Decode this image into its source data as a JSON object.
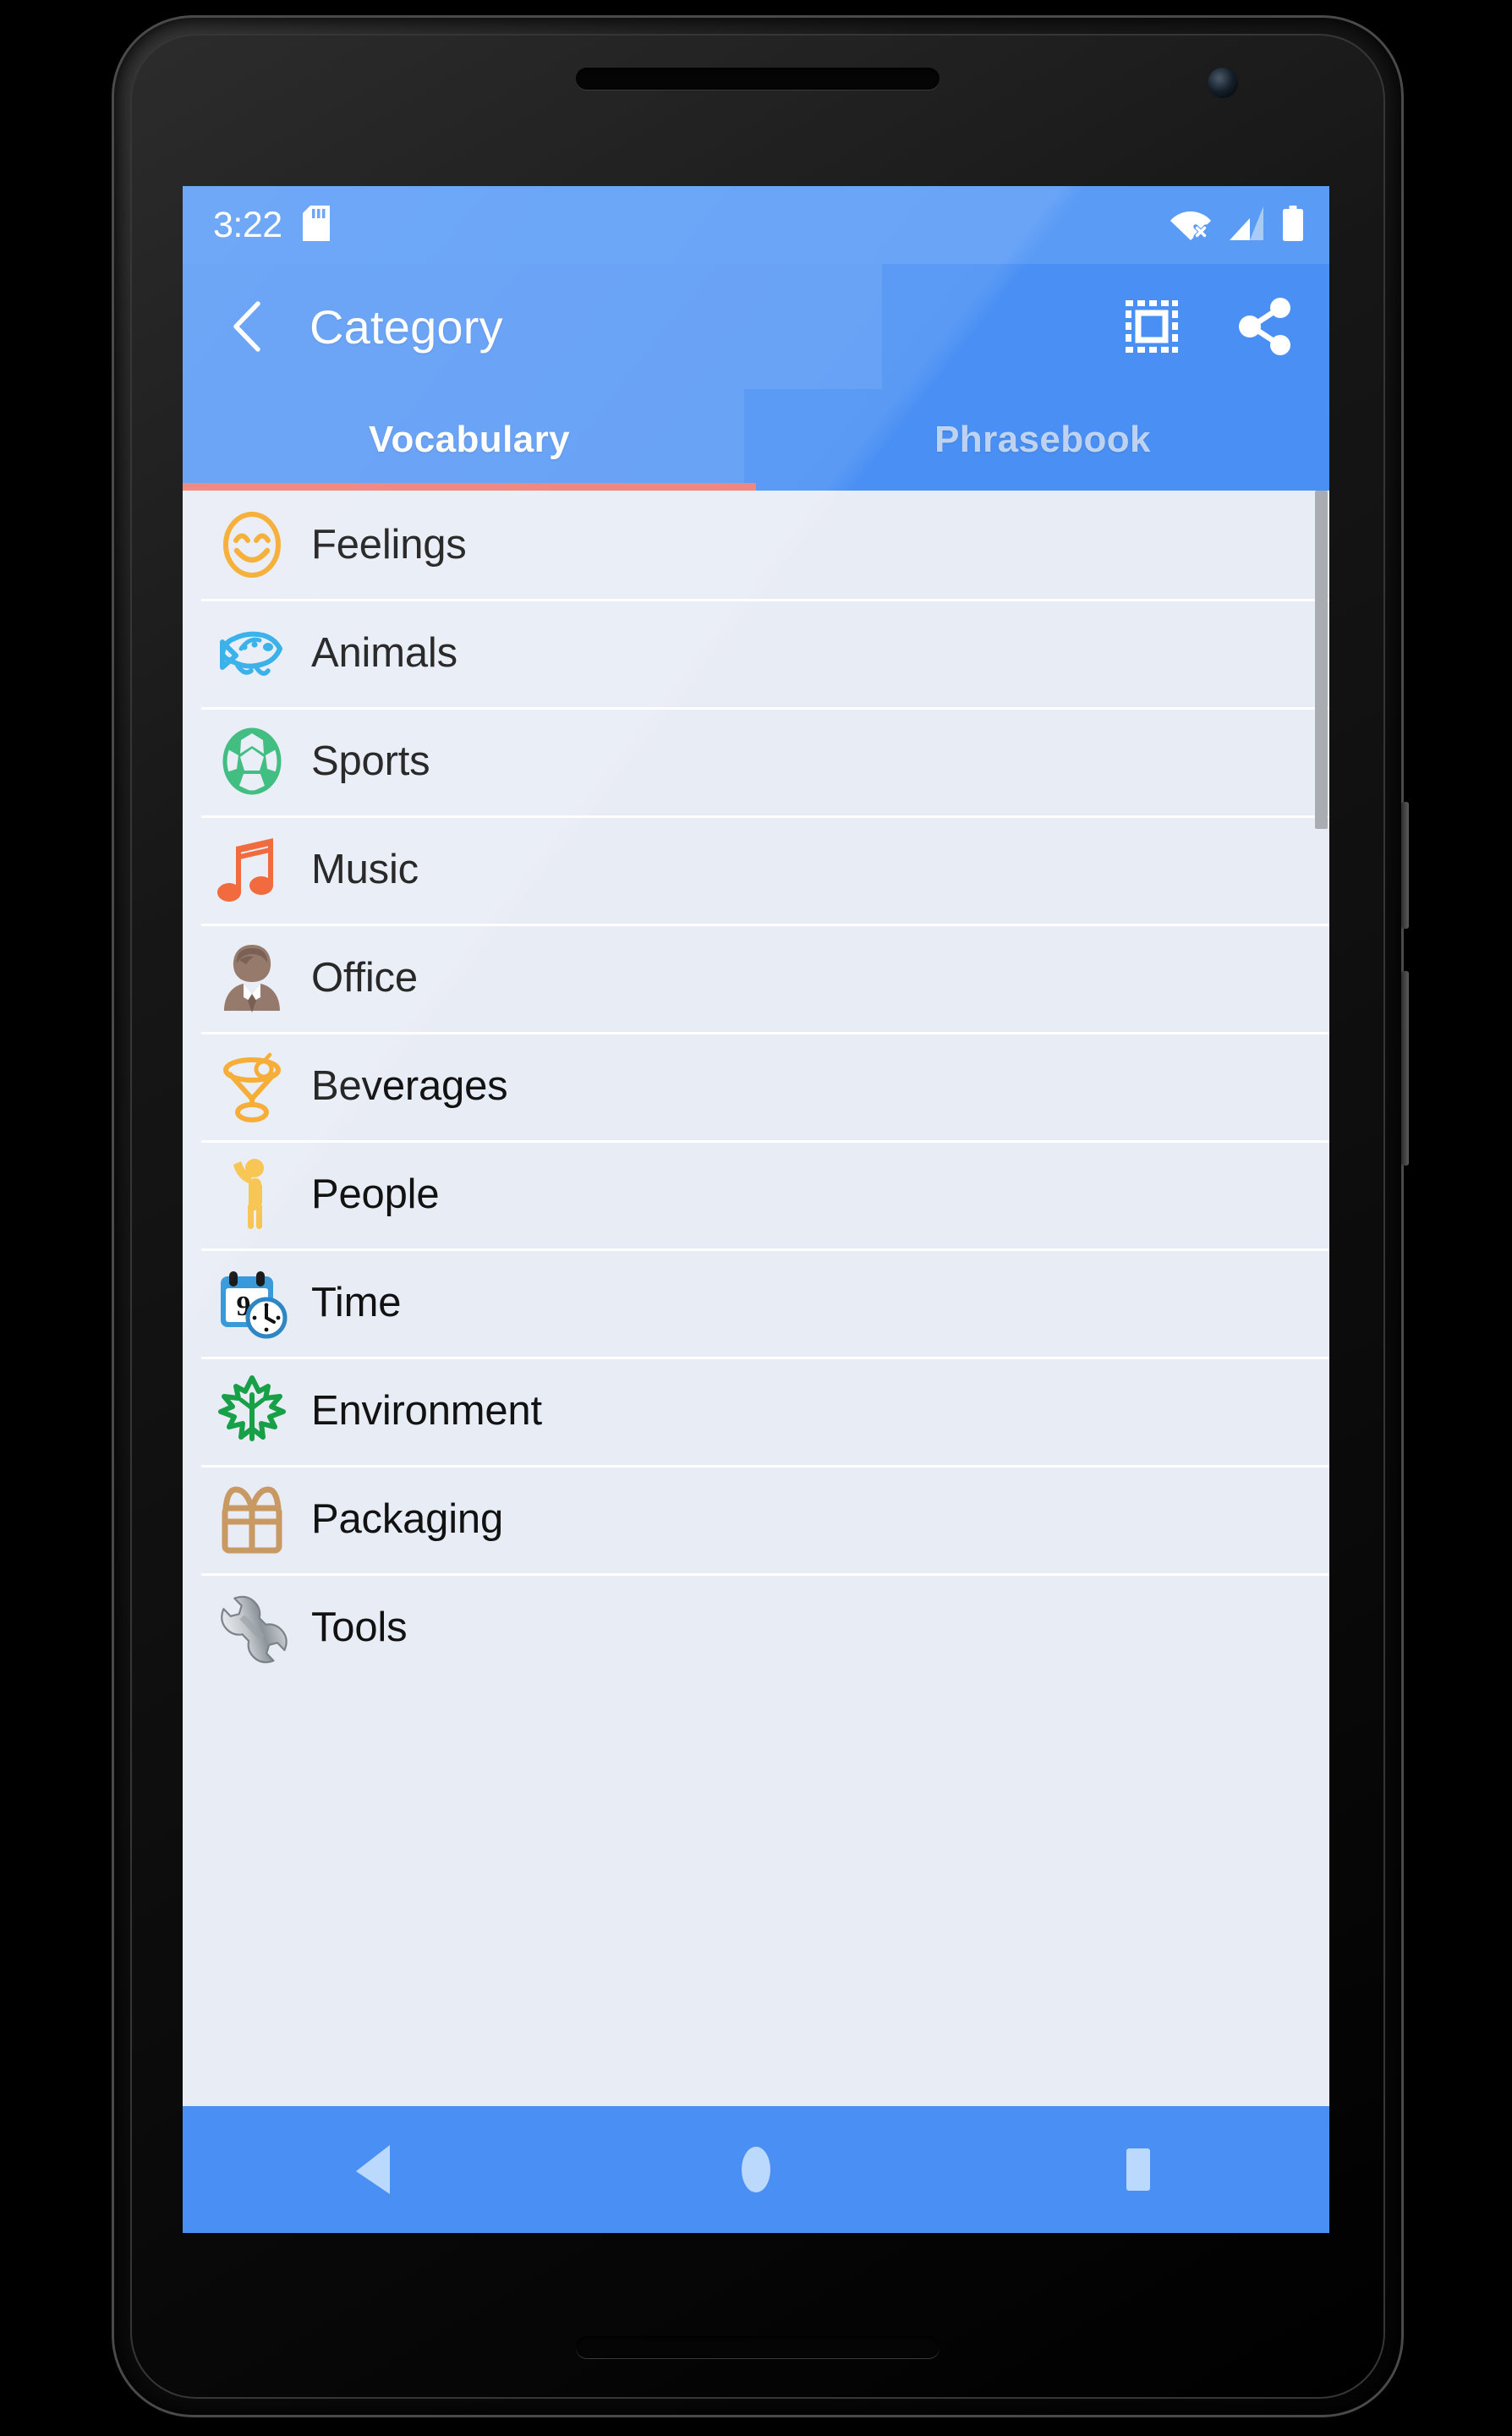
{
  "status_bar": {
    "time": "3:22",
    "icons": [
      "sd-card-icon",
      "wifi-no-connection-icon",
      "cellular-signal-icon",
      "battery-full-icon"
    ]
  },
  "toolbar": {
    "back_label": "back-icon",
    "title": "Category",
    "select_all_label": "select-all-icon",
    "share_label": "share-icon"
  },
  "tabs": {
    "active_index": 0,
    "indicator_color": "#EE7B72",
    "items": [
      {
        "label": "Vocabulary",
        "active": true
      },
      {
        "label": "Phrasebook",
        "active": false
      }
    ]
  },
  "list": {
    "items": [
      {
        "label": "Feelings",
        "icon": "smiley-face-icon",
        "color": "#F5A623"
      },
      {
        "label": "Animals",
        "icon": "fish-icon",
        "color": "#23A8E8"
      },
      {
        "label": "Sports",
        "icon": "soccer-ball-icon",
        "color": "#2BB673"
      },
      {
        "label": "Music",
        "icon": "music-note-icon",
        "color": "#F15A29"
      },
      {
        "label": "Office",
        "icon": "businessman-icon",
        "color": "#8A6B5C"
      },
      {
        "label": "Beverages",
        "icon": "cocktail-glass-icon",
        "color": "#F5A623"
      },
      {
        "label": "People",
        "icon": "person-waving-icon",
        "color": "#F7C043"
      },
      {
        "label": "Time",
        "icon": "calendar-clock-icon",
        "color": "#3A9AD9"
      },
      {
        "label": "Environment",
        "icon": "maple-leaf-icon",
        "color": "#17A048"
      },
      {
        "label": "Packaging",
        "icon": "gift-box-icon",
        "color": "#C99963"
      },
      {
        "label": "Tools",
        "icon": "wrench-icon",
        "color": "#9BA1A6"
      }
    ]
  },
  "nav_bar": {
    "back_label": "nav-back-icon",
    "home_label": "nav-home-icon",
    "recents_label": "nav-recents-icon"
  },
  "theme": {
    "primary": "#4A90F4",
    "status_bar": "#5A9BF6",
    "list_background": "#E8ECF5",
    "text": "#121212"
  }
}
